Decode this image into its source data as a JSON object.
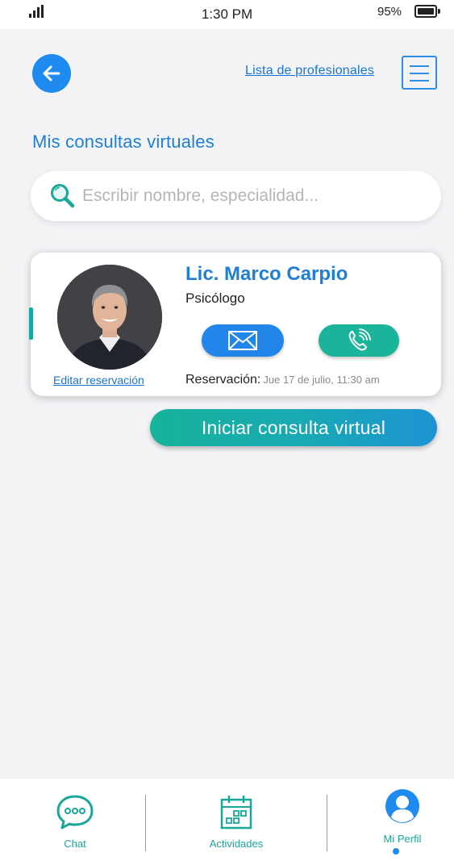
{
  "status": {
    "time": "1:30 PM",
    "battery": "95%"
  },
  "header": {
    "list_link": "Lista de profesionales"
  },
  "page": {
    "title": "Mis consultas virtuales"
  },
  "search": {
    "placeholder": "Escribir nombre, especialidad..."
  },
  "consultation": {
    "name": "Lic. Marco Carpio",
    "role": "Psicólogo",
    "edit_link": "Editar reservación",
    "reservation_label": "Reservación:",
    "reservation_value": "Jue 17 de julio, 11:30 am"
  },
  "actions": {
    "start": "Iniciar consulta virtual"
  },
  "nav": [
    {
      "label": "Chat",
      "icon": "chat-icon"
    },
    {
      "label": "Actividades",
      "icon": "calendar-icon"
    },
    {
      "label": "Mi Perfil",
      "icon": "user-icon",
      "active": true
    }
  ],
  "colors": {
    "primary": "#1f8bf0",
    "teal": "#17a89a",
    "title": "#1f7fd6"
  }
}
